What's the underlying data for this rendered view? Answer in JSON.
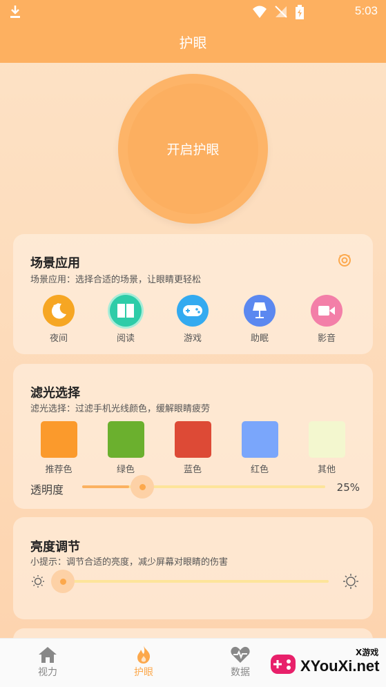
{
  "status": {
    "time": "5:03"
  },
  "header": {
    "title": "护眼"
  },
  "main_button": {
    "label": "开启护眼"
  },
  "scene": {
    "title": "场景应用",
    "subtitle": "场景应用：选择合适的场景，让眼睛更轻松",
    "items": [
      {
        "label": "夜间",
        "icon": "moon-icon",
        "color": "#f6a623"
      },
      {
        "label": "阅读",
        "icon": "book-icon",
        "color": "#2ecca8"
      },
      {
        "label": "游戏",
        "icon": "gamepad-icon",
        "color": "#33aaf0"
      },
      {
        "label": "助眠",
        "icon": "lamp-icon",
        "color": "#5b88f0"
      },
      {
        "label": "影音",
        "icon": "video-icon",
        "color": "#f37fa8"
      }
    ]
  },
  "filter": {
    "title": "滤光选择",
    "subtitle": "滤光选择：过滤手机光线颜色，缓解眼睛疲劳",
    "swatches": [
      {
        "label": "推荐色",
        "color": "#fb9a2c"
      },
      {
        "label": "绿色",
        "color": "#6bb02e"
      },
      {
        "label": "蓝色",
        "color": "#dd4a36"
      },
      {
        "label": "红色",
        "color": "#7aa6fb"
      },
      {
        "label": "其他",
        "color": "#f3f7cf"
      }
    ],
    "opacity_label": "透明度",
    "opacity_value": "25%",
    "opacity_fraction": 0.25
  },
  "brightness": {
    "title": "亮度调节",
    "subtitle": "小提示：调节合适的亮度，减少屏幕对眼睛的伤害",
    "level_fraction": 0.0
  },
  "nav": {
    "items": [
      {
        "label": "视力",
        "icon": "home-icon"
      },
      {
        "label": "护眼",
        "icon": "flame-icon"
      },
      {
        "label": "数据",
        "icon": "heartbeat-icon"
      }
    ]
  },
  "watermark": {
    "brand": "XYouXi.net",
    "small": "X游戏"
  },
  "colors": {
    "accent": "#fdb060",
    "active": "#fca84c"
  }
}
